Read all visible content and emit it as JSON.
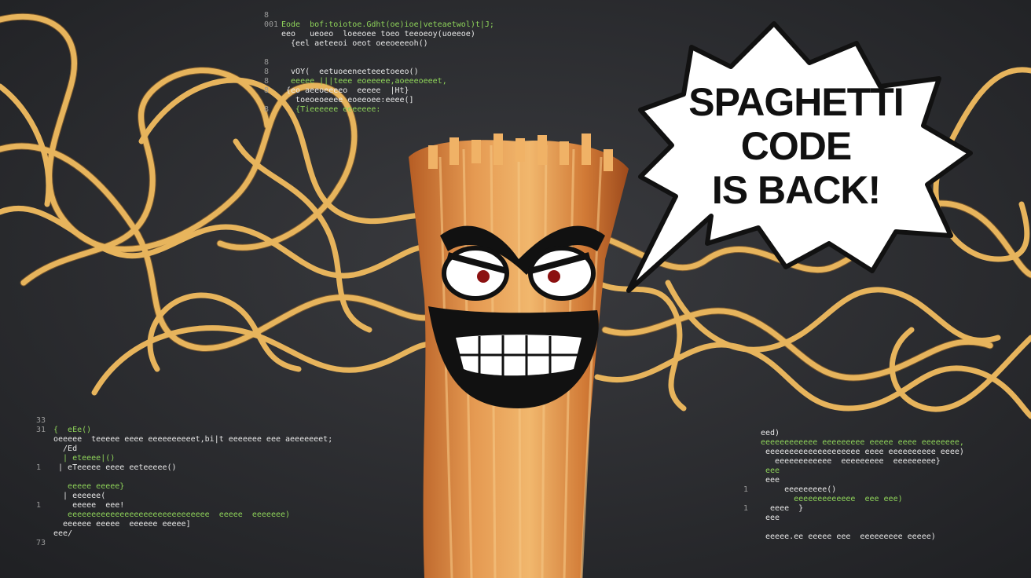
{
  "speech_bubble": {
    "lines": [
      "SPAGHETTI",
      "CODE",
      "IS BACK!"
    ]
  },
  "colors": {
    "background": "#2c2d30",
    "noodle": "#e7b45c",
    "noodle_shadow": "#b47a2e",
    "bubble_fill": "#ffffff",
    "bubble_text": "#111111",
    "code_text": "#e8e8e8",
    "code_red": "#ff6a5c",
    "code_green": "#8fd45a"
  },
  "code_snippets": {
    "top": [
      {
        "n": "8",
        "t": ""
      },
      {
        "n": "001",
        "t": "Eode  bof:toiotoe.Gdht(oe)ioe|veteaetwol)t|J;"
      },
      {
        "n": "",
        "t": "eeo   ueoeo  loeeoee toeo teeoeoy(uoeeoe)"
      },
      {
        "n": "",
        "t": "  {eel aeteeoi oeot oeeoeeeoh()"
      },
      {
        "n": "",
        "t": ""
      },
      {
        "n": "8",
        "t": ""
      },
      {
        "n": "8",
        "t": "  vOY(  eetuoeeneeteeetoeeo()"
      },
      {
        "n": "8",
        "t": "  eeeee |||teee eoeeeee,aoeeeoeeet,"
      },
      {
        "n": "8",
        "t": " {eo aeeoeeeeo  eeeee  |Ht}"
      },
      {
        "n": "",
        "t": "   toeoeoeeee eoeeoee:eeee(]"
      },
      {
        "n": "8",
        "t": "   {Tieeeeee eeeeeee:"
      }
    ],
    "left": [
      {
        "n": "33",
        "t": ""
      },
      {
        "n": "31",
        "t": "{  eEe()"
      },
      {
        "n": "",
        "t": "oeeeee  teeeee eeee eeeeeeeeeet,bi|t eeeeeee eee aeeeeeeet;"
      },
      {
        "n": "",
        "t": "  /Ed"
      },
      {
        "n": "",
        "t": "  | eteeee|()"
      },
      {
        "n": "1",
        "t": " | eTeeeee eeee eeteeeee()"
      },
      {
        "n": "",
        "t": ""
      },
      {
        "n": "",
        "t": "   eeeee eeeee}"
      },
      {
        "n": "",
        "t": "  | eeeeee("
      },
      {
        "n": "1",
        "t": "    eeeee  eee!"
      },
      {
        "n": "",
        "t": "   eeeeeeeeeeeeeeeeeeeeeeeeeeeeee  eeeee  eeeeeee)"
      },
      {
        "n": "",
        "t": "  eeeeee eeeee  eeeeee eeeee]"
      },
      {
        "n": "",
        "t": "eee/"
      },
      {
        "n": "73",
        "t": ""
      }
    ],
    "right": [
      {
        "n": "",
        "t": "eed)"
      },
      {
        "n": "",
        "t": "eeeeeeeeeeee eeeeeeeee eeeee eeee eeeeeeee,"
      },
      {
        "n": "",
        "t": " eeeeeeeeeeeeeeeeeeee eeee eeeeeeeeee eeee)"
      },
      {
        "n": "",
        "t": "   eeeeeeeeeeee  eeeeeeeee  eeeeeeeee}"
      },
      {
        "n": "",
        "t": " eee"
      },
      {
        "n": "",
        "t": " eee"
      },
      {
        "n": "1",
        "t": "     eeeeeeeee()"
      },
      {
        "n": "",
        "t": "       eeeeeeeeeeeee  eee eee)"
      },
      {
        "n": "1",
        "t": "  eeee  }"
      },
      {
        "n": "",
        "t": " eee"
      },
      {
        "n": "",
        "t": ""
      },
      {
        "n": "",
        "t": " eeeee.ee eeeee eee  eeeeeeeee eeeee)"
      }
    ]
  }
}
